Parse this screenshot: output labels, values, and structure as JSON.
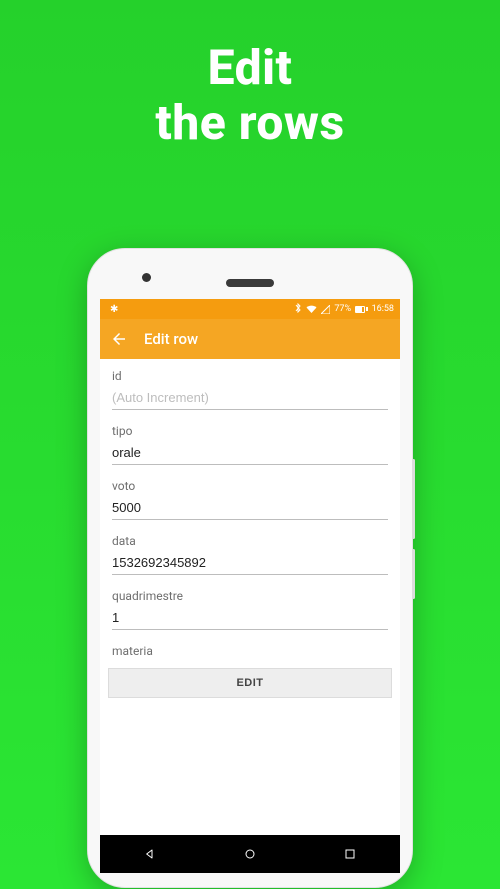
{
  "promo": {
    "line1": "Edit",
    "line2": "the rows"
  },
  "status": {
    "battery_pct": "77%",
    "time": "16:58"
  },
  "appbar": {
    "title": "Edit row"
  },
  "fields": [
    {
      "label": "id",
      "value": "",
      "placeholder": "(Auto Increment)"
    },
    {
      "label": "tipo",
      "value": "orale",
      "placeholder": ""
    },
    {
      "label": "voto",
      "value": "5000",
      "placeholder": ""
    },
    {
      "label": "data",
      "value": "1532692345892",
      "placeholder": ""
    },
    {
      "label": "quadrimestre",
      "value": "1",
      "placeholder": ""
    },
    {
      "label": "materia",
      "value": "",
      "placeholder": ""
    }
  ],
  "edit_button": "EDIT"
}
